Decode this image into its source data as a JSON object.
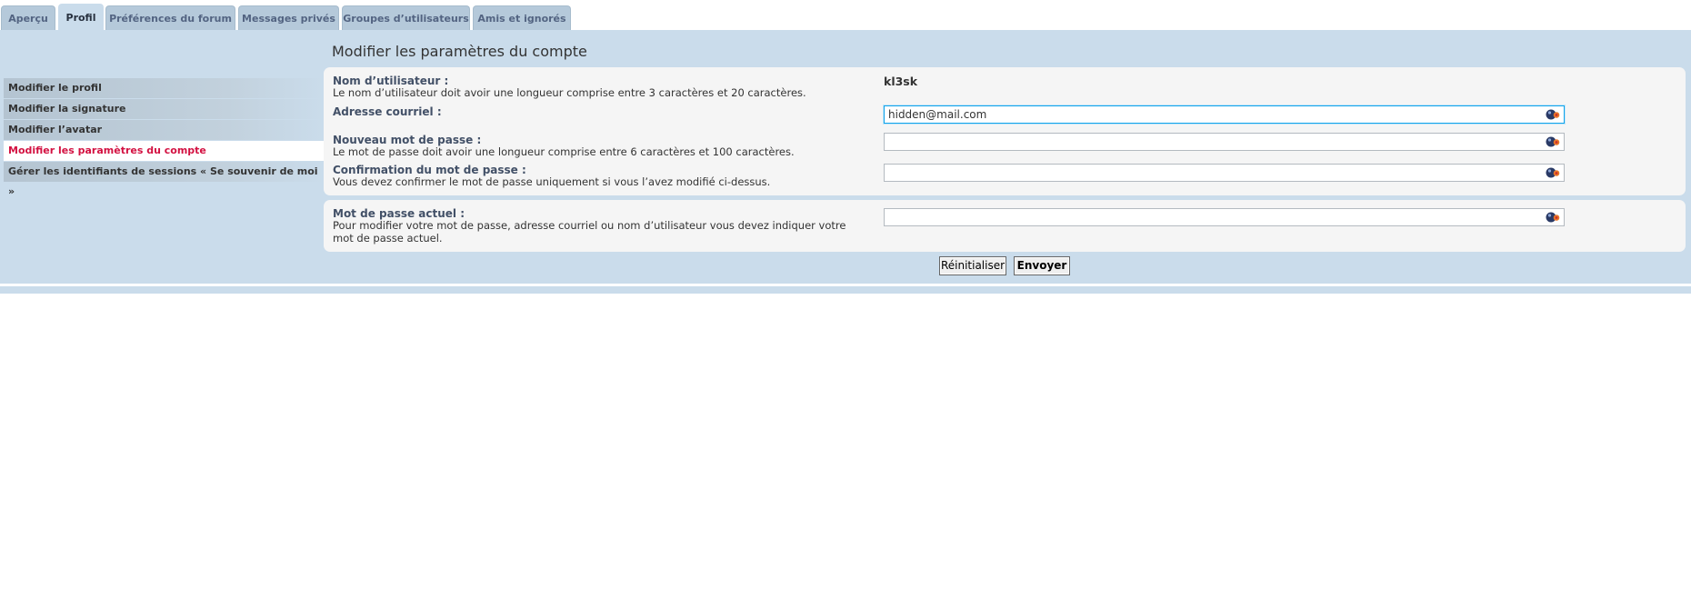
{
  "tabs": [
    {
      "label": "Aperçu"
    },
    {
      "label": "Profil"
    },
    {
      "label": "Préférences du forum"
    },
    {
      "label": "Messages privés"
    },
    {
      "label": "Groupes d’utilisateurs"
    },
    {
      "label": "Amis et ignorés"
    }
  ],
  "page_title": "Modifier les paramètres du compte",
  "menu": [
    {
      "label": "Modifier le profil"
    },
    {
      "label": "Modifier la signature"
    },
    {
      "label": "Modifier l’avatar"
    },
    {
      "label": "Modifier les paramètres du compte"
    },
    {
      "label": "Gérer les identifiants de sessions « Se souvenir de moi »"
    }
  ],
  "form": {
    "username_label": "Nom d’utilisateur :",
    "username_explain": "Le nom d’utilisateur doit avoir une longueur comprise entre 3 caractères et 20 caractères.",
    "username_value": "kl3sk",
    "email_label": "Adresse courriel :",
    "email_value": "hidden@mail.com",
    "new_password_label": "Nouveau mot de passe :",
    "new_password_explain": "Le mot de passe doit avoir une longueur comprise entre 6 caractères et 100 caractères.",
    "confirm_password_label": "Confirmation du mot de passe :",
    "confirm_password_explain": "Vous devez confirmer le mot de passe uniquement si vous l’avez modifié ci-dessus.",
    "current_password_label": "Mot de passe actuel :",
    "current_password_explain": "Pour modifier votre mot de passe, adresse courriel ou nom d’utilisateur vous devez indiquer votre mot de passe actuel."
  },
  "buttons": {
    "reset_label": "Réinitialiser",
    "submit_label": "Envoyer"
  },
  "colors": {
    "panel_bg": "#cadceb",
    "active_menu_text": "#d31141",
    "label_text": "#425067",
    "focus_border": "#11a3ea"
  },
  "icons": {
    "password_manager": "password-manager-icon"
  }
}
